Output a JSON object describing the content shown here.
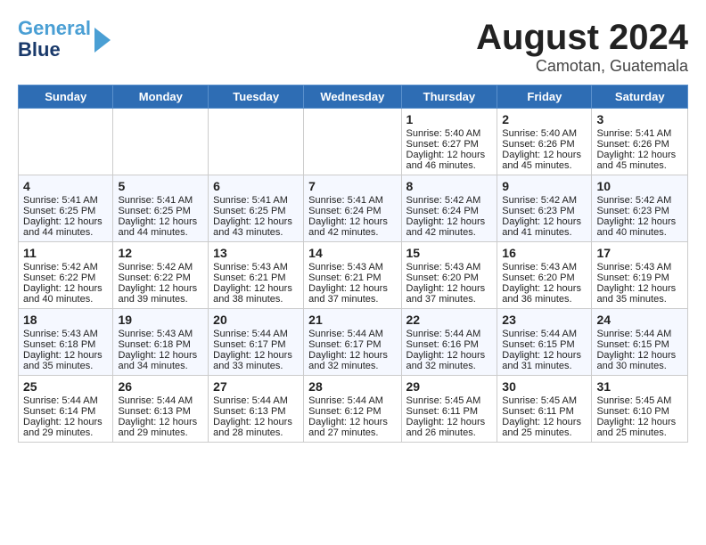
{
  "logo": {
    "line1": "General",
    "line2": "Blue"
  },
  "title": "August 2024",
  "subtitle": "Camotan, Guatemala",
  "days_of_week": [
    "Sunday",
    "Monday",
    "Tuesday",
    "Wednesday",
    "Thursday",
    "Friday",
    "Saturday"
  ],
  "weeks": [
    [
      {
        "day": "",
        "sunrise": "",
        "sunset": "",
        "daylight": ""
      },
      {
        "day": "",
        "sunrise": "",
        "sunset": "",
        "daylight": ""
      },
      {
        "day": "",
        "sunrise": "",
        "sunset": "",
        "daylight": ""
      },
      {
        "day": "",
        "sunrise": "",
        "sunset": "",
        "daylight": ""
      },
      {
        "day": "1",
        "sunrise": "Sunrise: 5:40 AM",
        "sunset": "Sunset: 6:27 PM",
        "daylight": "Daylight: 12 hours and 46 minutes."
      },
      {
        "day": "2",
        "sunrise": "Sunrise: 5:40 AM",
        "sunset": "Sunset: 6:26 PM",
        "daylight": "Daylight: 12 hours and 45 minutes."
      },
      {
        "day": "3",
        "sunrise": "Sunrise: 5:41 AM",
        "sunset": "Sunset: 6:26 PM",
        "daylight": "Daylight: 12 hours and 45 minutes."
      }
    ],
    [
      {
        "day": "4",
        "sunrise": "Sunrise: 5:41 AM",
        "sunset": "Sunset: 6:25 PM",
        "daylight": "Daylight: 12 hours and 44 minutes."
      },
      {
        "day": "5",
        "sunrise": "Sunrise: 5:41 AM",
        "sunset": "Sunset: 6:25 PM",
        "daylight": "Daylight: 12 hours and 44 minutes."
      },
      {
        "day": "6",
        "sunrise": "Sunrise: 5:41 AM",
        "sunset": "Sunset: 6:25 PM",
        "daylight": "Daylight: 12 hours and 43 minutes."
      },
      {
        "day": "7",
        "sunrise": "Sunrise: 5:41 AM",
        "sunset": "Sunset: 6:24 PM",
        "daylight": "Daylight: 12 hours and 42 minutes."
      },
      {
        "day": "8",
        "sunrise": "Sunrise: 5:42 AM",
        "sunset": "Sunset: 6:24 PM",
        "daylight": "Daylight: 12 hours and 42 minutes."
      },
      {
        "day": "9",
        "sunrise": "Sunrise: 5:42 AM",
        "sunset": "Sunset: 6:23 PM",
        "daylight": "Daylight: 12 hours and 41 minutes."
      },
      {
        "day": "10",
        "sunrise": "Sunrise: 5:42 AM",
        "sunset": "Sunset: 6:23 PM",
        "daylight": "Daylight: 12 hours and 40 minutes."
      }
    ],
    [
      {
        "day": "11",
        "sunrise": "Sunrise: 5:42 AM",
        "sunset": "Sunset: 6:22 PM",
        "daylight": "Daylight: 12 hours and 40 minutes."
      },
      {
        "day": "12",
        "sunrise": "Sunrise: 5:42 AM",
        "sunset": "Sunset: 6:22 PM",
        "daylight": "Daylight: 12 hours and 39 minutes."
      },
      {
        "day": "13",
        "sunrise": "Sunrise: 5:43 AM",
        "sunset": "Sunset: 6:21 PM",
        "daylight": "Daylight: 12 hours and 38 minutes."
      },
      {
        "day": "14",
        "sunrise": "Sunrise: 5:43 AM",
        "sunset": "Sunset: 6:21 PM",
        "daylight": "Daylight: 12 hours and 37 minutes."
      },
      {
        "day": "15",
        "sunrise": "Sunrise: 5:43 AM",
        "sunset": "Sunset: 6:20 PM",
        "daylight": "Daylight: 12 hours and 37 minutes."
      },
      {
        "day": "16",
        "sunrise": "Sunrise: 5:43 AM",
        "sunset": "Sunset: 6:20 PM",
        "daylight": "Daylight: 12 hours and 36 minutes."
      },
      {
        "day": "17",
        "sunrise": "Sunrise: 5:43 AM",
        "sunset": "Sunset: 6:19 PM",
        "daylight": "Daylight: 12 hours and 35 minutes."
      }
    ],
    [
      {
        "day": "18",
        "sunrise": "Sunrise: 5:43 AM",
        "sunset": "Sunset: 6:18 PM",
        "daylight": "Daylight: 12 hours and 35 minutes."
      },
      {
        "day": "19",
        "sunrise": "Sunrise: 5:43 AM",
        "sunset": "Sunset: 6:18 PM",
        "daylight": "Daylight: 12 hours and 34 minutes."
      },
      {
        "day": "20",
        "sunrise": "Sunrise: 5:44 AM",
        "sunset": "Sunset: 6:17 PM",
        "daylight": "Daylight: 12 hours and 33 minutes."
      },
      {
        "day": "21",
        "sunrise": "Sunrise: 5:44 AM",
        "sunset": "Sunset: 6:17 PM",
        "daylight": "Daylight: 12 hours and 32 minutes."
      },
      {
        "day": "22",
        "sunrise": "Sunrise: 5:44 AM",
        "sunset": "Sunset: 6:16 PM",
        "daylight": "Daylight: 12 hours and 32 minutes."
      },
      {
        "day": "23",
        "sunrise": "Sunrise: 5:44 AM",
        "sunset": "Sunset: 6:15 PM",
        "daylight": "Daylight: 12 hours and 31 minutes."
      },
      {
        "day": "24",
        "sunrise": "Sunrise: 5:44 AM",
        "sunset": "Sunset: 6:15 PM",
        "daylight": "Daylight: 12 hours and 30 minutes."
      }
    ],
    [
      {
        "day": "25",
        "sunrise": "Sunrise: 5:44 AM",
        "sunset": "Sunset: 6:14 PM",
        "daylight": "Daylight: 12 hours and 29 minutes."
      },
      {
        "day": "26",
        "sunrise": "Sunrise: 5:44 AM",
        "sunset": "Sunset: 6:13 PM",
        "daylight": "Daylight: 12 hours and 29 minutes."
      },
      {
        "day": "27",
        "sunrise": "Sunrise: 5:44 AM",
        "sunset": "Sunset: 6:13 PM",
        "daylight": "Daylight: 12 hours and 28 minutes."
      },
      {
        "day": "28",
        "sunrise": "Sunrise: 5:44 AM",
        "sunset": "Sunset: 6:12 PM",
        "daylight": "Daylight: 12 hours and 27 minutes."
      },
      {
        "day": "29",
        "sunrise": "Sunrise: 5:45 AM",
        "sunset": "Sunset: 6:11 PM",
        "daylight": "Daylight: 12 hours and 26 minutes."
      },
      {
        "day": "30",
        "sunrise": "Sunrise: 5:45 AM",
        "sunset": "Sunset: 6:11 PM",
        "daylight": "Daylight: 12 hours and 25 minutes."
      },
      {
        "day": "31",
        "sunrise": "Sunrise: 5:45 AM",
        "sunset": "Sunset: 6:10 PM",
        "daylight": "Daylight: 12 hours and 25 minutes."
      }
    ]
  ]
}
